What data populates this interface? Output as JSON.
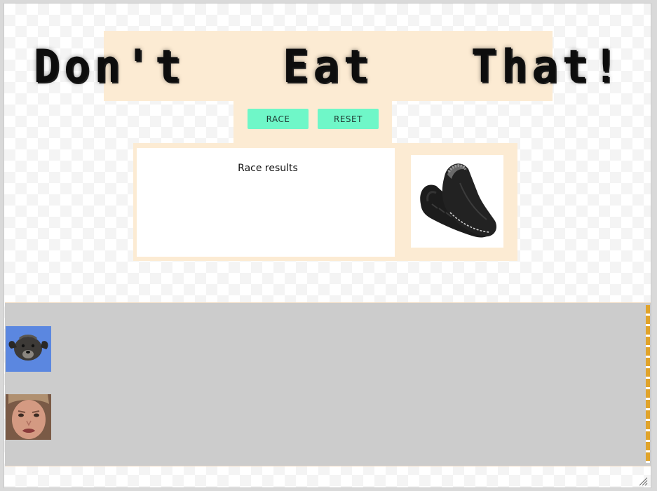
{
  "app": {
    "title": "Don't  Eat  That!"
  },
  "controls": {
    "race_label": "RACE",
    "reset_label": "RESET"
  },
  "results": {
    "title": "Race results"
  },
  "food": {
    "icon": "slipper-shoe-image"
  },
  "racers": [
    {
      "name": "dog",
      "icon": "dog-avatar"
    },
    {
      "name": "person",
      "icon": "person-avatar"
    }
  ],
  "colors": {
    "banner_bg": "#fcebd3",
    "button_bg": "#6ff7c8",
    "track_bg": "#cccccc",
    "finish_line": "#e0a32a",
    "dog_bg": "#5b87e0"
  }
}
